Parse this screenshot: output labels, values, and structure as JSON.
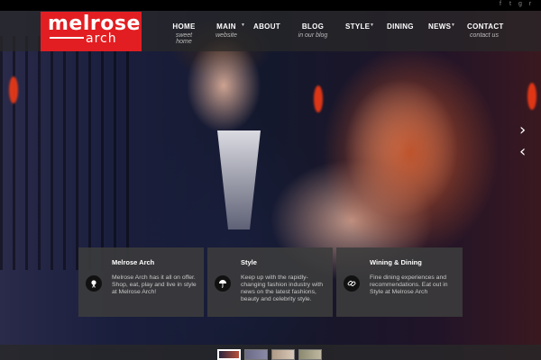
{
  "header": {
    "logo": {
      "line1": "melrose",
      "line2": "arch"
    },
    "social": [
      {
        "name": "facebook-icon",
        "glyph": "f"
      },
      {
        "name": "twitter-icon",
        "glyph": "t"
      },
      {
        "name": "gplus-icon",
        "glyph": "g"
      },
      {
        "name": "rss-icon",
        "glyph": "r"
      }
    ],
    "nav": [
      {
        "label": "HOME",
        "sub": "sweet home"
      },
      {
        "label": "MAIN",
        "sub": "website"
      },
      {
        "label": "ABOUT",
        "sub": ""
      },
      {
        "label": "BLOG",
        "sub": "in our blog"
      },
      {
        "label": "STYLE",
        "sub": ""
      },
      {
        "label": "DINING",
        "sub": ""
      },
      {
        "label": "NEWS",
        "sub": ""
      },
      {
        "label": "CONTACT",
        "sub": "contact us"
      }
    ]
  },
  "slider": {
    "next_arrow": "›",
    "prev_arrow": "‹"
  },
  "features": [
    {
      "title": "Melrose Arch",
      "text": "Melrose Arch has it all on offer. Shop, eat, play and live in style at Melrose Arch!",
      "icon": "pin-icon"
    },
    {
      "title": "Style",
      "text": "Keep up with the rapidly-changing fashion industry with news on the latest fashions, beauty and celebrity style.",
      "icon": "umbrella-icon"
    },
    {
      "title": "Wining & Dining",
      "text": "Fine dining experiences and recommendations. Eat out in Style at Melrose Arch",
      "icon": "link-icon"
    }
  ],
  "colors": {
    "brand_red": "#e21e22",
    "header_bg": "#282828",
    "box_bg": "#3c3c3c"
  }
}
